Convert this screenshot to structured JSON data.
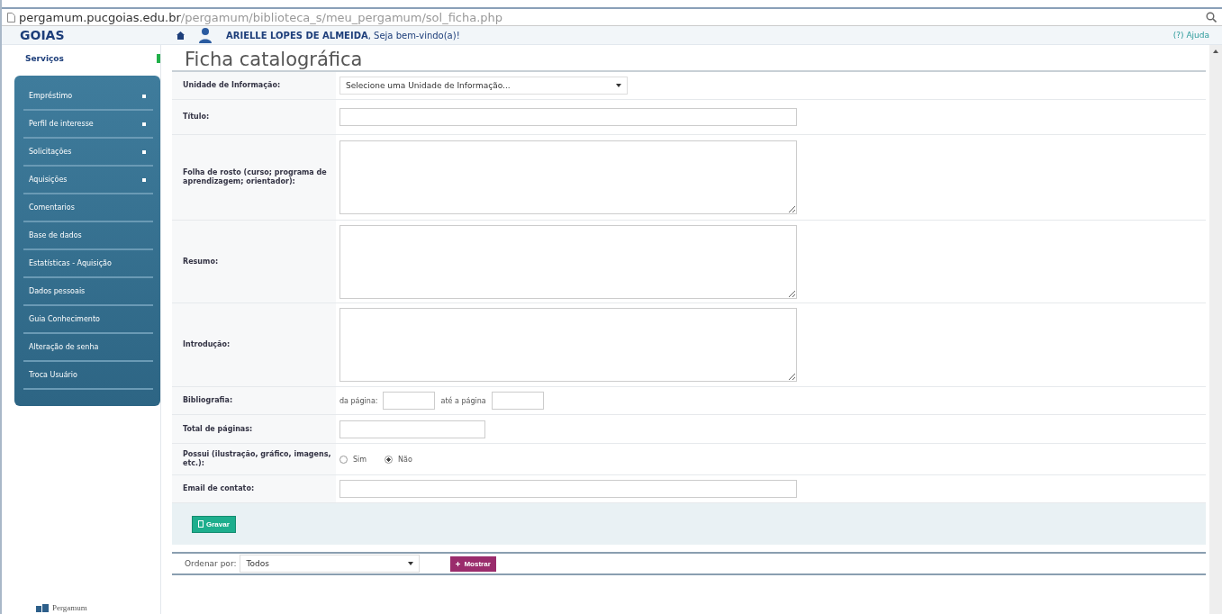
{
  "address_bar": {
    "host": "pergamum.pucgoias.edu.br",
    "path": "/pergamum/biblioteca_s/meu_pergamum/sol_ficha.php"
  },
  "header": {
    "logo_text": "GOIAS",
    "user_name": "ARIELLE LOPES DE ALMEIDA",
    "greeting": ", Seja bem-vindo(a)!",
    "help": "(?) Ajuda"
  },
  "sidebar": {
    "title": "Serviços",
    "items": [
      {
        "label": "Empréstimo",
        "has_submenu": true
      },
      {
        "label": "Perfil de interesse",
        "has_submenu": true
      },
      {
        "label": "Solicitações",
        "has_submenu": true
      },
      {
        "label": "Aquisições",
        "has_submenu": true
      },
      {
        "label": "Comentarios",
        "has_submenu": false
      },
      {
        "label": "Base de dados",
        "has_submenu": false
      },
      {
        "label": "Estatísticas - Aquisição",
        "has_submenu": false
      },
      {
        "label": "Dados pessoais",
        "has_submenu": false
      },
      {
        "label": "Guia Conhecimento",
        "has_submenu": false
      },
      {
        "label": "Alteração de senha",
        "has_submenu": false
      },
      {
        "label": "Troca Usuário",
        "has_submenu": false
      }
    ],
    "footer": "Pergamum"
  },
  "page_title": "Ficha catalográfica",
  "form": {
    "rows": [
      {
        "kind": "select",
        "label": "Unidade de Informação:",
        "value": "Selecione uma Unidade de Informação..."
      },
      {
        "kind": "text",
        "label": "Título:"
      },
      {
        "kind": "textarea",
        "label": "Folha de rosto (curso; programa de aprendizagem; orientador):"
      },
      {
        "kind": "textarea",
        "label": "Resumo:"
      },
      {
        "kind": "textarea",
        "label": "Introdução:"
      },
      {
        "kind": "range",
        "label": "Bibliografia:",
        "from_label": "da página:",
        "to_label": "até a página"
      },
      {
        "kind": "short",
        "label": "Total de páginas:"
      },
      {
        "kind": "radio",
        "label": "Possui (ilustração, gráfico, imagens, etc.):",
        "options": [
          {
            "label": "Sim",
            "selected": false
          },
          {
            "label": "Não",
            "selected": true
          }
        ]
      },
      {
        "kind": "text",
        "label": "Email de contato:"
      }
    ],
    "save_button": "Gravar"
  },
  "sort_bar": {
    "label": "Ordenar por:",
    "value": "Todos",
    "button": "Mostrar"
  }
}
